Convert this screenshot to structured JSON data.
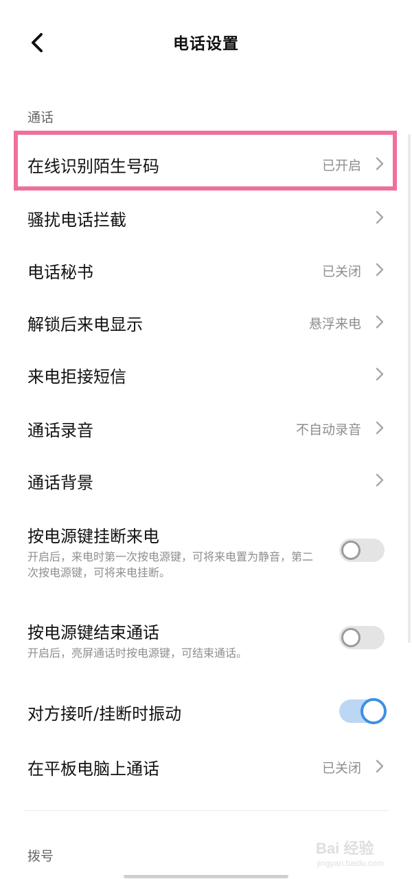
{
  "header": {
    "title": "电话设置",
    "back_icon": "back-arrow-icon"
  },
  "sections": [
    {
      "title": "通话",
      "items": [
        {
          "label": "在线识别陌生号码",
          "value": "已开启",
          "type": "link"
        },
        {
          "label": "骚扰电话拦截",
          "value": "",
          "type": "link"
        },
        {
          "label": "电话秘书",
          "value": "已关闭",
          "type": "link"
        },
        {
          "label": "解锁后来电显示",
          "value": "悬浮来电",
          "type": "link"
        },
        {
          "label": "来电拒接短信",
          "value": "",
          "type": "link"
        },
        {
          "label": "通话录音",
          "value": "不自动录音",
          "type": "link"
        },
        {
          "label": "通话背景",
          "value": "",
          "type": "link"
        },
        {
          "label": "按电源键挂断来电",
          "description": "开启后，来电时第一次按电源键，可将来电置为静音，第二次按电源键，可将来电挂断。",
          "type": "toggle",
          "enabled": false
        },
        {
          "label": "按电源键结束通话",
          "description": "开启后，亮屏通话时按电源键，可结束通话。",
          "type": "toggle",
          "enabled": false
        },
        {
          "label": "对方接听/挂断时振动",
          "type": "toggle",
          "enabled": true
        },
        {
          "label": "在平板电脑上通话",
          "value": "已关闭",
          "type": "link"
        }
      ]
    },
    {
      "title": "拨号"
    }
  ],
  "watermark": {
    "main": "Bai 经验",
    "sub": "jingyan.baidu.com"
  },
  "colors": {
    "highlight": "#f0709a",
    "toggle_on": "#3f8fe3",
    "toggle_on_track": "#bcd7f3",
    "toggle_off_track": "#e4e4e4",
    "secondary_text": "#8e8e8e"
  }
}
